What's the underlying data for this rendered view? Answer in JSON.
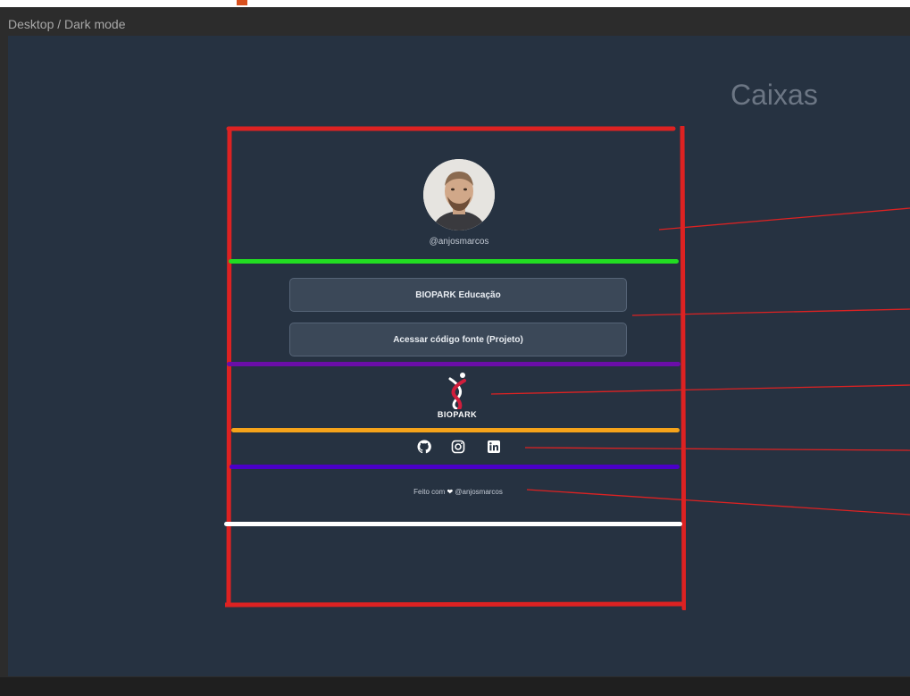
{
  "frame": {
    "label": "Desktop / Dark mode"
  },
  "notes": {
    "title": "Caixas"
  },
  "profile": {
    "handle": "@anjosmarcos"
  },
  "links": [
    {
      "label": "BIOPARK Educação"
    },
    {
      "label": "Acessar código fonte (Projeto)"
    }
  ],
  "brand": {
    "name": "BIOPARK"
  },
  "social": [
    {
      "icon": "github-icon"
    },
    {
      "icon": "instagram-icon"
    },
    {
      "icon": "linkedin-icon"
    }
  ],
  "footer": {
    "prefix": "Feito com",
    "heart": "❤",
    "author": "@anjosmarcos"
  },
  "colors": {
    "canvas": "#263241",
    "button": "#3b4858",
    "annotation_red": "#dd2222",
    "annotation_green": "#22dd22",
    "annotation_purple": "#6a0ea8",
    "annotation_orange": "#f5a31a",
    "annotation_indigo": "#4a00c8",
    "annotation_white": "#ffffff"
  }
}
